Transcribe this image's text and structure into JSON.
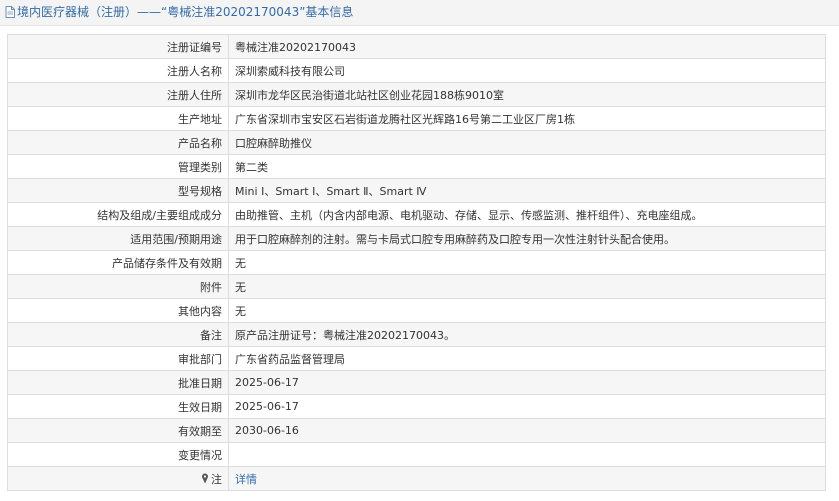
{
  "header": {
    "title": "境内医疗器械（注册）——“粤械注准20202170043”基本信息",
    "icon": "document-icon"
  },
  "rows": [
    {
      "label": "注册证编号",
      "value": "粤械注准20202170043"
    },
    {
      "label": "注册人名称",
      "value": "深圳索威科技有限公司"
    },
    {
      "label": "注册人住所",
      "value": "深圳市龙华区民治街道北站社区创业花园188栋9010室"
    },
    {
      "label": "生产地址",
      "value": "广东省深圳市宝安区石岩街道龙腾社区光辉路16号第二工业区厂房1栋"
    },
    {
      "label": "产品名称",
      "value": "口腔麻醉助推仪"
    },
    {
      "label": "管理类别",
      "value": "第二类"
    },
    {
      "label": "型号规格",
      "value": "Mini Ⅰ、Smart Ⅰ、Smart Ⅱ、Smart Ⅳ"
    },
    {
      "label": "结构及组成/主要组成成分",
      "value": "由助推管、主机（内含内部电源、电机驱动、存储、显示、传感监测、推杆组件）、充电座组成。"
    },
    {
      "label": "适用范围/预期用途",
      "value": "用于口腔麻醉剂的注射。需与卡局式口腔专用麻醉药及口腔专用一次性注射针头配合使用。"
    },
    {
      "label": "产品储存条件及有效期",
      "value": "无"
    },
    {
      "label": "附件",
      "value": "无"
    },
    {
      "label": "其他内容",
      "value": "无"
    },
    {
      "label": "备注",
      "value": "原产品注册证号：粤械注准20202170043。"
    },
    {
      "label": "审批部门",
      "value": "广东省药品监督管理局"
    },
    {
      "label": "批准日期",
      "value": "2025-06-17"
    },
    {
      "label": "生效日期",
      "value": "2025-06-17"
    },
    {
      "label": "有效期至",
      "value": "2030-06-16"
    },
    {
      "label": "变更情况",
      "value": ""
    }
  ],
  "note_row": {
    "label": "注",
    "link_text": "详情",
    "icon": "pin-icon"
  },
  "colors": {
    "accent": "#336ba8",
    "border": "#dddddd",
    "stripe": "#f6f6f6"
  }
}
